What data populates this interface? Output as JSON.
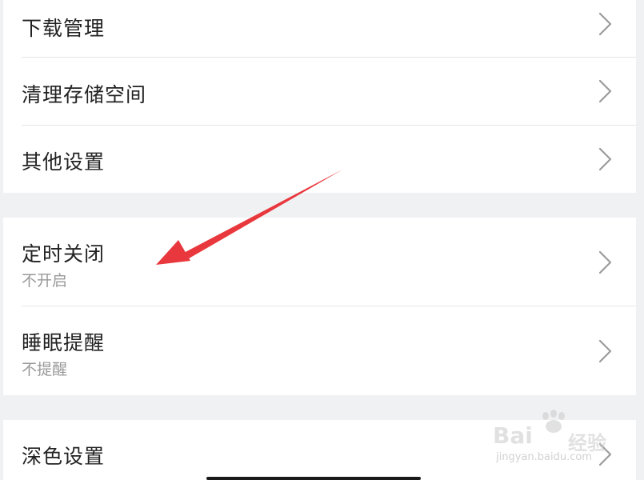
{
  "settings": {
    "group1": [
      {
        "title": "下载管理"
      },
      {
        "title": "清理存储空间"
      },
      {
        "title": "其他设置"
      }
    ],
    "group2": [
      {
        "title": "定时关闭",
        "subtitle": "不开启"
      },
      {
        "title": "睡眠提醒",
        "subtitle": "不提醒"
      }
    ],
    "group3": [
      {
        "title": "深色设置"
      }
    ]
  },
  "watermark": {
    "brand_left": "Bai",
    "brand_right": "经验",
    "url": "jingyan.baidu.com"
  },
  "colors": {
    "annotation_arrow": "#e8383d",
    "page_background": "#f0f1f3",
    "row_background": "#ffffff"
  },
  "icons": {
    "chevron": "chevron-right-icon",
    "annotation": "red-arrow-annotation"
  }
}
